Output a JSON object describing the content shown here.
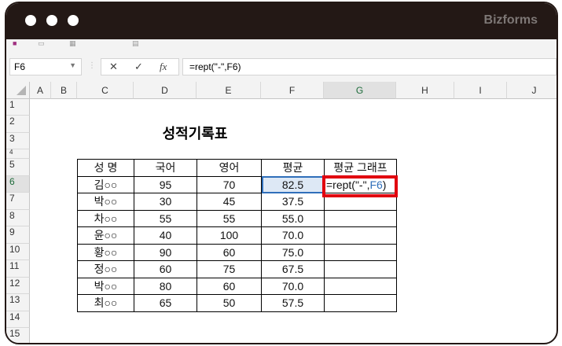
{
  "window": {
    "brand": "Bizforms"
  },
  "formula_bar": {
    "name_box": "F6",
    "cancel_icon": "✕",
    "enter_icon": "✓",
    "fx_label": "fx",
    "formula": "=rept(\"-\",F6)"
  },
  "columns": [
    "A",
    "B",
    "C",
    "D",
    "E",
    "F",
    "G",
    "H",
    "I",
    "J"
  ],
  "rows": [
    "1",
    "2",
    "3",
    "4",
    "5",
    "6",
    "7",
    "8",
    "9",
    "10",
    "11",
    "12",
    "13",
    "14",
    "15"
  ],
  "sheet": {
    "title": "성적기록표",
    "headers": [
      "성 명",
      "국어",
      "영어",
      "평균",
      "평균 그래프"
    ],
    "records": [
      [
        "김○○",
        "95",
        "70",
        "82.5"
      ],
      [
        "박○○",
        "30",
        "45",
        "37.5"
      ],
      [
        "차○○",
        "55",
        "55",
        "55.0"
      ],
      [
        "윤○○",
        "40",
        "100",
        "70.0"
      ],
      [
        "황○○",
        "90",
        "60",
        "75.0"
      ],
      [
        "정○○",
        "60",
        "75",
        "67.5"
      ],
      [
        "박○○",
        "80",
        "60",
        "70.0"
      ],
      [
        "최○○",
        "65",
        "50",
        "57.5"
      ]
    ],
    "editing_cell": {
      "prefix": "=rept(\"-\",",
      "ref": "F6",
      "suffix": ")"
    }
  }
}
